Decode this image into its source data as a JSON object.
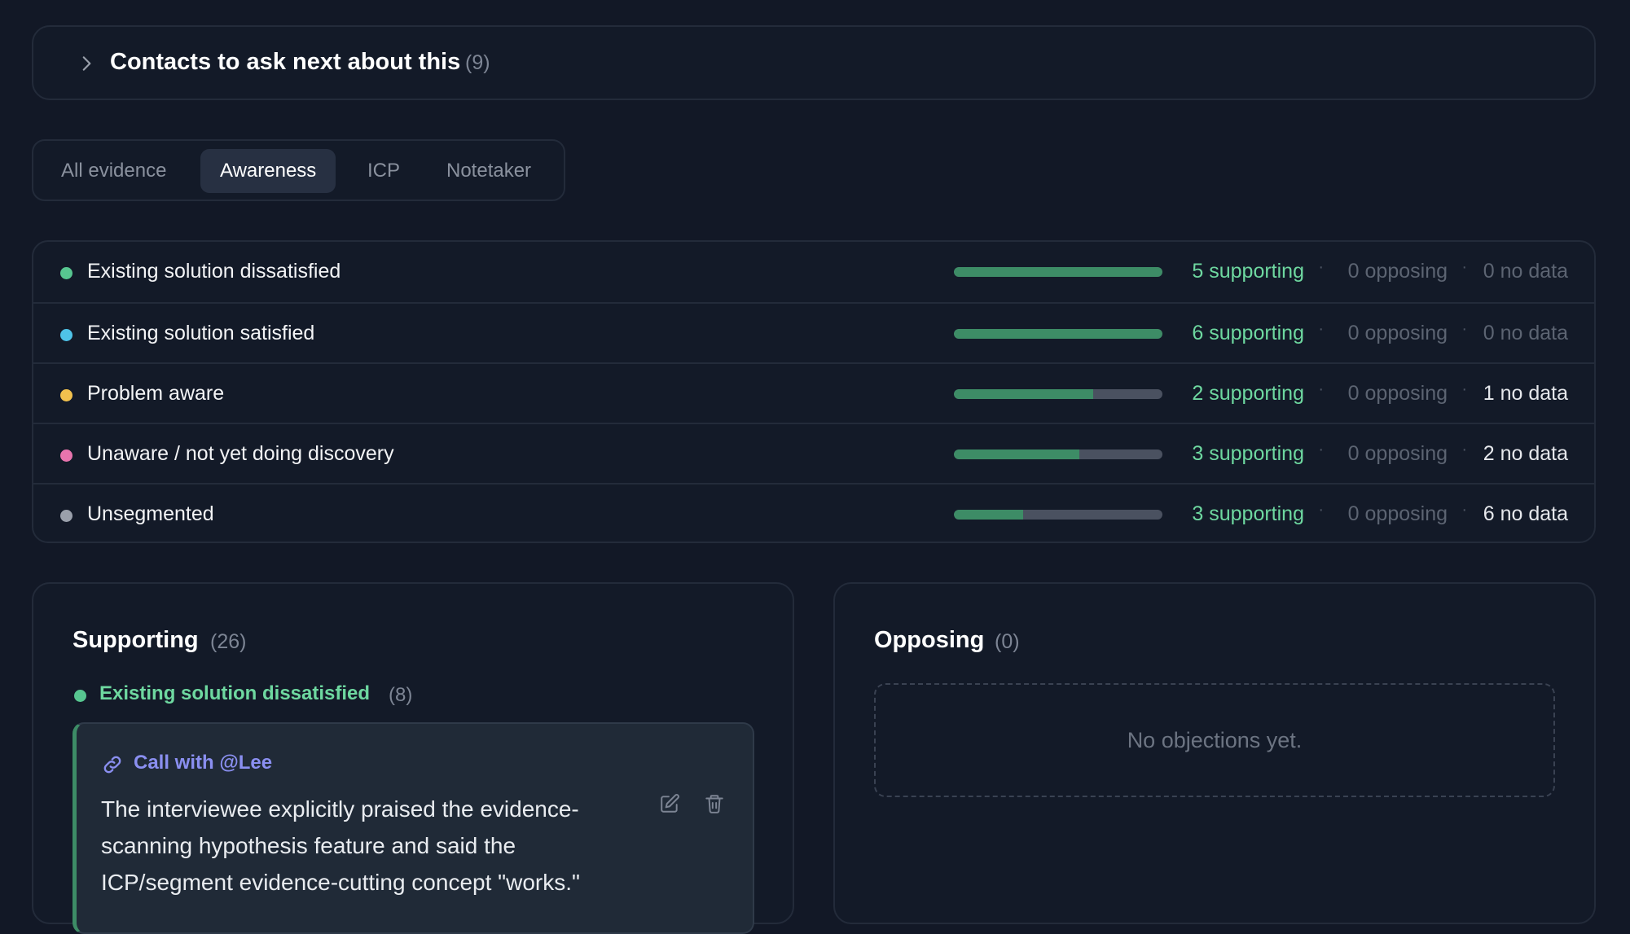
{
  "contacts": {
    "title": "Contacts to ask next about this",
    "count": "(9)"
  },
  "tabs": [
    {
      "label": "All evidence",
      "active": false
    },
    {
      "label": "Awareness",
      "active": true
    },
    {
      "label": "ICP",
      "active": false
    },
    {
      "label": "Notetaker",
      "active": false
    }
  ],
  "segments": [
    {
      "name": "Existing solution dissatisfied",
      "dot_color": "#57c690",
      "supporting_fraction": 1.0,
      "supporting": "5 supporting",
      "opposing": "0 opposing",
      "no_data": "0 no data",
      "no_data_muted": true
    },
    {
      "name": "Existing solution satisfied",
      "dot_color": "#4fc3e8",
      "supporting_fraction": 1.0,
      "supporting": "6 supporting",
      "opposing": "0 opposing",
      "no_data": "0 no data",
      "no_data_muted": true
    },
    {
      "name": "Problem aware",
      "dot_color": "#f2c14e",
      "supporting_fraction": 0.667,
      "supporting": "2 supporting",
      "opposing": "0 opposing",
      "no_data": "1 no data",
      "no_data_muted": false
    },
    {
      "name": "Unaware / not yet doing discovery",
      "dot_color": "#e874ad",
      "supporting_fraction": 0.6,
      "supporting": "3 supporting",
      "opposing": "0 opposing",
      "no_data": "2 no data",
      "no_data_muted": false
    },
    {
      "name": "Unsegmented",
      "dot_color": "#9aa0ab",
      "supporting_fraction": 0.333,
      "supporting": "3 supporting",
      "opposing": "0 opposing",
      "no_data": "6 no data",
      "no_data_muted": false
    }
  ],
  "separator": "·",
  "supporting": {
    "title": "Supporting",
    "count": "(26)",
    "group": {
      "label": "Existing solution dissatisfied",
      "count": "(8)"
    },
    "evidence": {
      "source": "Call with @Lee",
      "quote": "The interviewee explicitly praised the evidence-scanning hypothesis feature and said the ICP/segment evidence-cutting concept \"works.\"",
      "icons": [
        "link-icon",
        "edit-icon",
        "trash-icon"
      ]
    }
  },
  "opposing": {
    "title": "Opposing",
    "count": "(0)",
    "empty_text": "No objections yet."
  },
  "colors": {
    "background": "#121826",
    "accent_green": "#6ed8a0",
    "bar_fill": "#3d8c66",
    "link_purple": "#8a8ff0"
  }
}
